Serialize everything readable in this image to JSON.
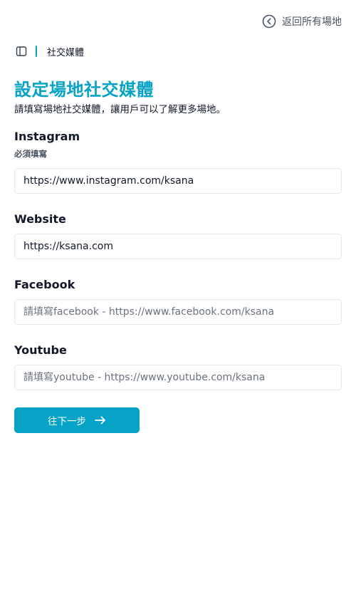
{
  "header": {
    "back_label": "返回所有場地",
    "back_icon": "chevron-left-circle-icon"
  },
  "breadcrumb": {
    "toggle_icon": "sidebar-toggle-icon",
    "current": "社交媒體"
  },
  "main": {
    "title": "設定場地社交媒體",
    "subtitle": "請填寫場地社交媒體，讓用戶可以了解更多場地。"
  },
  "form": {
    "instagram": {
      "label": "Instagram",
      "hint": "必須填寫",
      "value": "https://www.instagram.com/ksana",
      "placeholder": ""
    },
    "website": {
      "label": "Website",
      "value": "https://ksana.com",
      "placeholder": ""
    },
    "facebook": {
      "label": "Facebook",
      "value": "",
      "placeholder": "請填寫facebook - https://www.facebook.com/ksana"
    },
    "youtube": {
      "label": "Youtube",
      "value": "",
      "placeholder": "請填寫youtube - https://www.youtube.com/ksana"
    },
    "next_label": "往下一步",
    "next_icon": "arrow-right-icon"
  },
  "colors": {
    "accent": "#06a3c6",
    "text": "#111827",
    "muted": "#4b5563",
    "border": "#e5e7eb"
  }
}
